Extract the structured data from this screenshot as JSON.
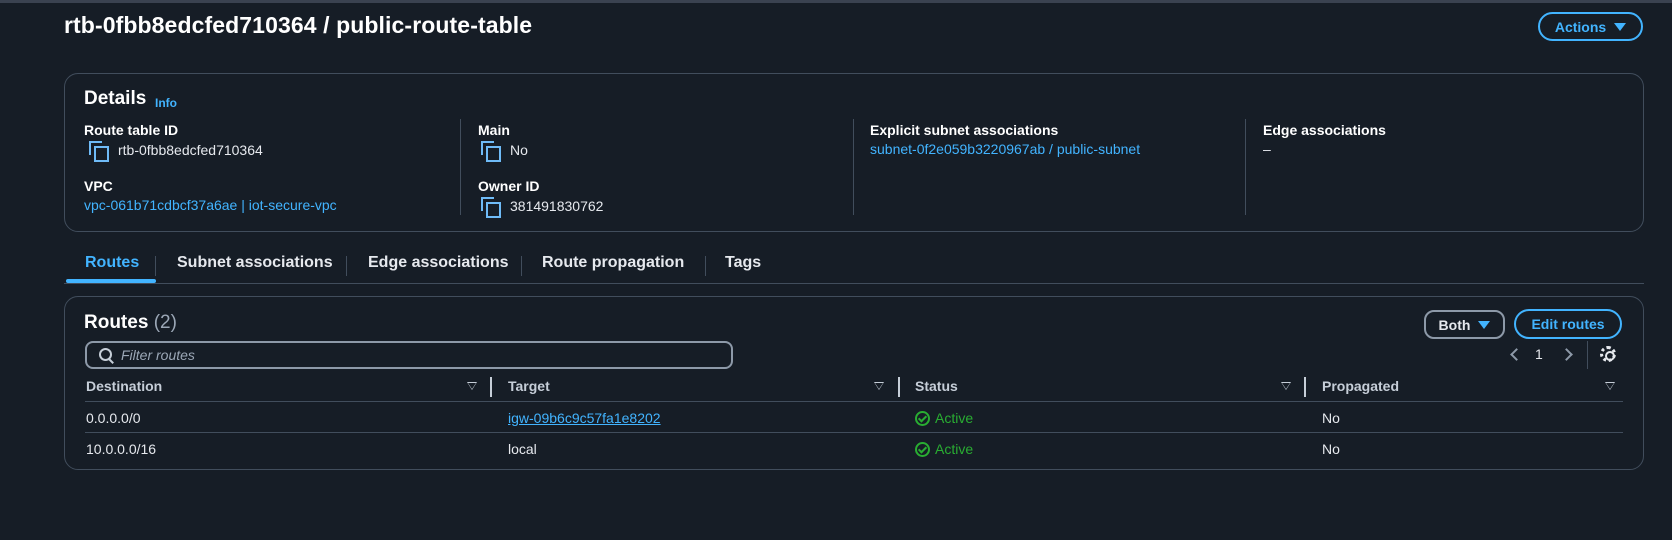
{
  "header": {
    "title": "rtb-0fbb8edcfed710364 / public-route-table",
    "actions_label": "Actions"
  },
  "details": {
    "heading": "Details",
    "info": "Info",
    "route_table_id": {
      "label": "Route table ID",
      "value": "rtb-0fbb8edcfed710364"
    },
    "main": {
      "label": "Main",
      "value": "No"
    },
    "explicit_subnet": {
      "label": "Explicit subnet associations",
      "value": "subnet-0f2e059b3220967ab / public-subnet"
    },
    "edge": {
      "label": "Edge associations",
      "value": "–"
    },
    "vpc": {
      "label": "VPC",
      "value": "vpc-061b71cdbcf37a6ae | iot-secure-vpc"
    },
    "owner_id": {
      "label": "Owner ID",
      "value": "381491830762"
    }
  },
  "tabs": [
    {
      "label": "Routes",
      "active": true
    },
    {
      "label": "Subnet associations"
    },
    {
      "label": "Edge associations"
    },
    {
      "label": "Route propagation"
    },
    {
      "label": "Tags"
    }
  ],
  "routes": {
    "heading": "Routes",
    "count": "(2)",
    "filter_label": "Both",
    "edit_label": "Edit routes",
    "search_placeholder": "Filter routes",
    "page": "1",
    "columns": [
      "Destination",
      "Target",
      "Status",
      "Propagated"
    ],
    "rows": [
      {
        "destination": "0.0.0.0/0",
        "target": "igw-09b6c9c57fa1e8202",
        "status": "Active",
        "propagated": "No"
      },
      {
        "destination": "10.0.0.0/16",
        "target": "local",
        "status": "Active",
        "propagated": "No"
      }
    ]
  },
  "colors": {
    "accent": "#42b4ff",
    "success": "#29ad32",
    "background": "#161d26"
  },
  "icons": [
    "copy-icon",
    "search-icon",
    "chevron-left-icon",
    "chevron-right-icon",
    "gear-icon",
    "check-circle-icon",
    "caret-down-icon",
    "sort-icon"
  ]
}
